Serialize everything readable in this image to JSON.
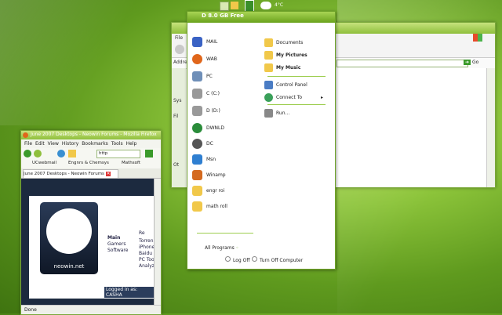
{
  "taskbar": {
    "items": [
      {
        "icon": "window-icon"
      },
      {
        "icon": "folder-icon"
      },
      {
        "icon": "folder-icon"
      },
      {
        "icon": "recycle-bin-icon"
      },
      {
        "icon": "cloud-weather-icon"
      }
    ],
    "temp": "4°C"
  },
  "explorer": {
    "menu_label": "File",
    "address_label": "Addre",
    "side_labels": [
      "Sys",
      "Fil",
      "Ot"
    ],
    "go_label": "Go"
  },
  "start_menu": {
    "header": "D 8.0 GB Free",
    "left_items": [
      {
        "label": "MAIL",
        "icon": "mail-icon",
        "color": "#3a62c4"
      },
      {
        "label": "WAB",
        "icon": "firefox-icon",
        "color": "#e0661b"
      },
      {
        "label": "PC",
        "icon": "computer-icon",
        "color": "#6f8fb8"
      },
      {
        "label": "C (C:)",
        "icon": "drive-icon",
        "color": "#999999"
      },
      {
        "label": "D (D:)",
        "icon": "drive-icon",
        "color": "#999999"
      },
      {
        "label": "DWNLD",
        "icon": "download-icon",
        "color": "#2a8c3a"
      },
      {
        "label": "DC",
        "icon": "dc-icon",
        "color": "#555555"
      },
      {
        "label": "Msn",
        "icon": "msn-icon",
        "color": "#2f7fd1"
      },
      {
        "label": "Winamp",
        "icon": "winamp-icon",
        "color": "#d46a1f"
      },
      {
        "label": "engr roi",
        "icon": "folder-icon",
        "color": "#f1c84a"
      },
      {
        "label": "math roll",
        "icon": "folder-icon",
        "color": "#f1c84a"
      }
    ],
    "right_items": [
      {
        "label": "Documents",
        "icon": "documents-icon",
        "color": "#f1c84a"
      },
      {
        "label": "My Pictures",
        "icon": "pictures-icon",
        "color": "#f1c84a"
      },
      {
        "label": "My Music",
        "icon": "music-icon",
        "color": "#f1c84a"
      },
      {
        "label": "Control Panel",
        "icon": "control-panel-icon",
        "color": "#4a7cc4"
      },
      {
        "label": "Connect To",
        "icon": "connect-icon",
        "color": "#3aa05a"
      },
      {
        "label": "Run...",
        "icon": "run-icon",
        "color": "#888888"
      }
    ],
    "all_programs": "All Programs",
    "log_off": "Log Off",
    "turn_off": "Turn Off Computer"
  },
  "firefox": {
    "title": "June 2007 Desktops - Neowin Forums - Mozilla Firefox",
    "menu": [
      "File",
      "Edit",
      "View",
      "History",
      "Bookmarks",
      "Tools",
      "Help"
    ],
    "url": "http",
    "bookmarks": [
      "UCwebmail",
      "Engnrs & Chemsys",
      "Mathsoft"
    ],
    "tab": "June 2007 Desktops - Neowin Forums",
    "logo_text": "neowin.net",
    "site_links": [
      "Main",
      "Gamers",
      "Software"
    ],
    "side_links": [
      "Re",
      "Torren",
      "iPhone",
      "Baidu",
      "PC Too",
      "Analyz"
    ],
    "logged_in": "Logged in as: CASHA",
    "status": "Done"
  }
}
